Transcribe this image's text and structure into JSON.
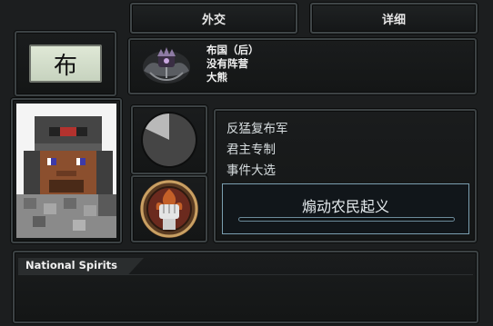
{
  "tabs": {
    "diplomacy_label": "外交",
    "details_label": "详细"
  },
  "country": {
    "flag_char": "布",
    "name": "布国（后）",
    "faction": "没有阵营",
    "leader": "大熊"
  },
  "ideology": {
    "line1": "反猛复布军",
    "line2": "君主专制",
    "line3": "事件大选",
    "decision_label": "煽动农民起义",
    "decision_progress": 0
  },
  "popularity_pie": {
    "dominant_share": 0.82,
    "dominant_color": "#454545",
    "minor_color": "#b9b9b9"
  },
  "spirits": {
    "label": "National Spirits"
  }
}
